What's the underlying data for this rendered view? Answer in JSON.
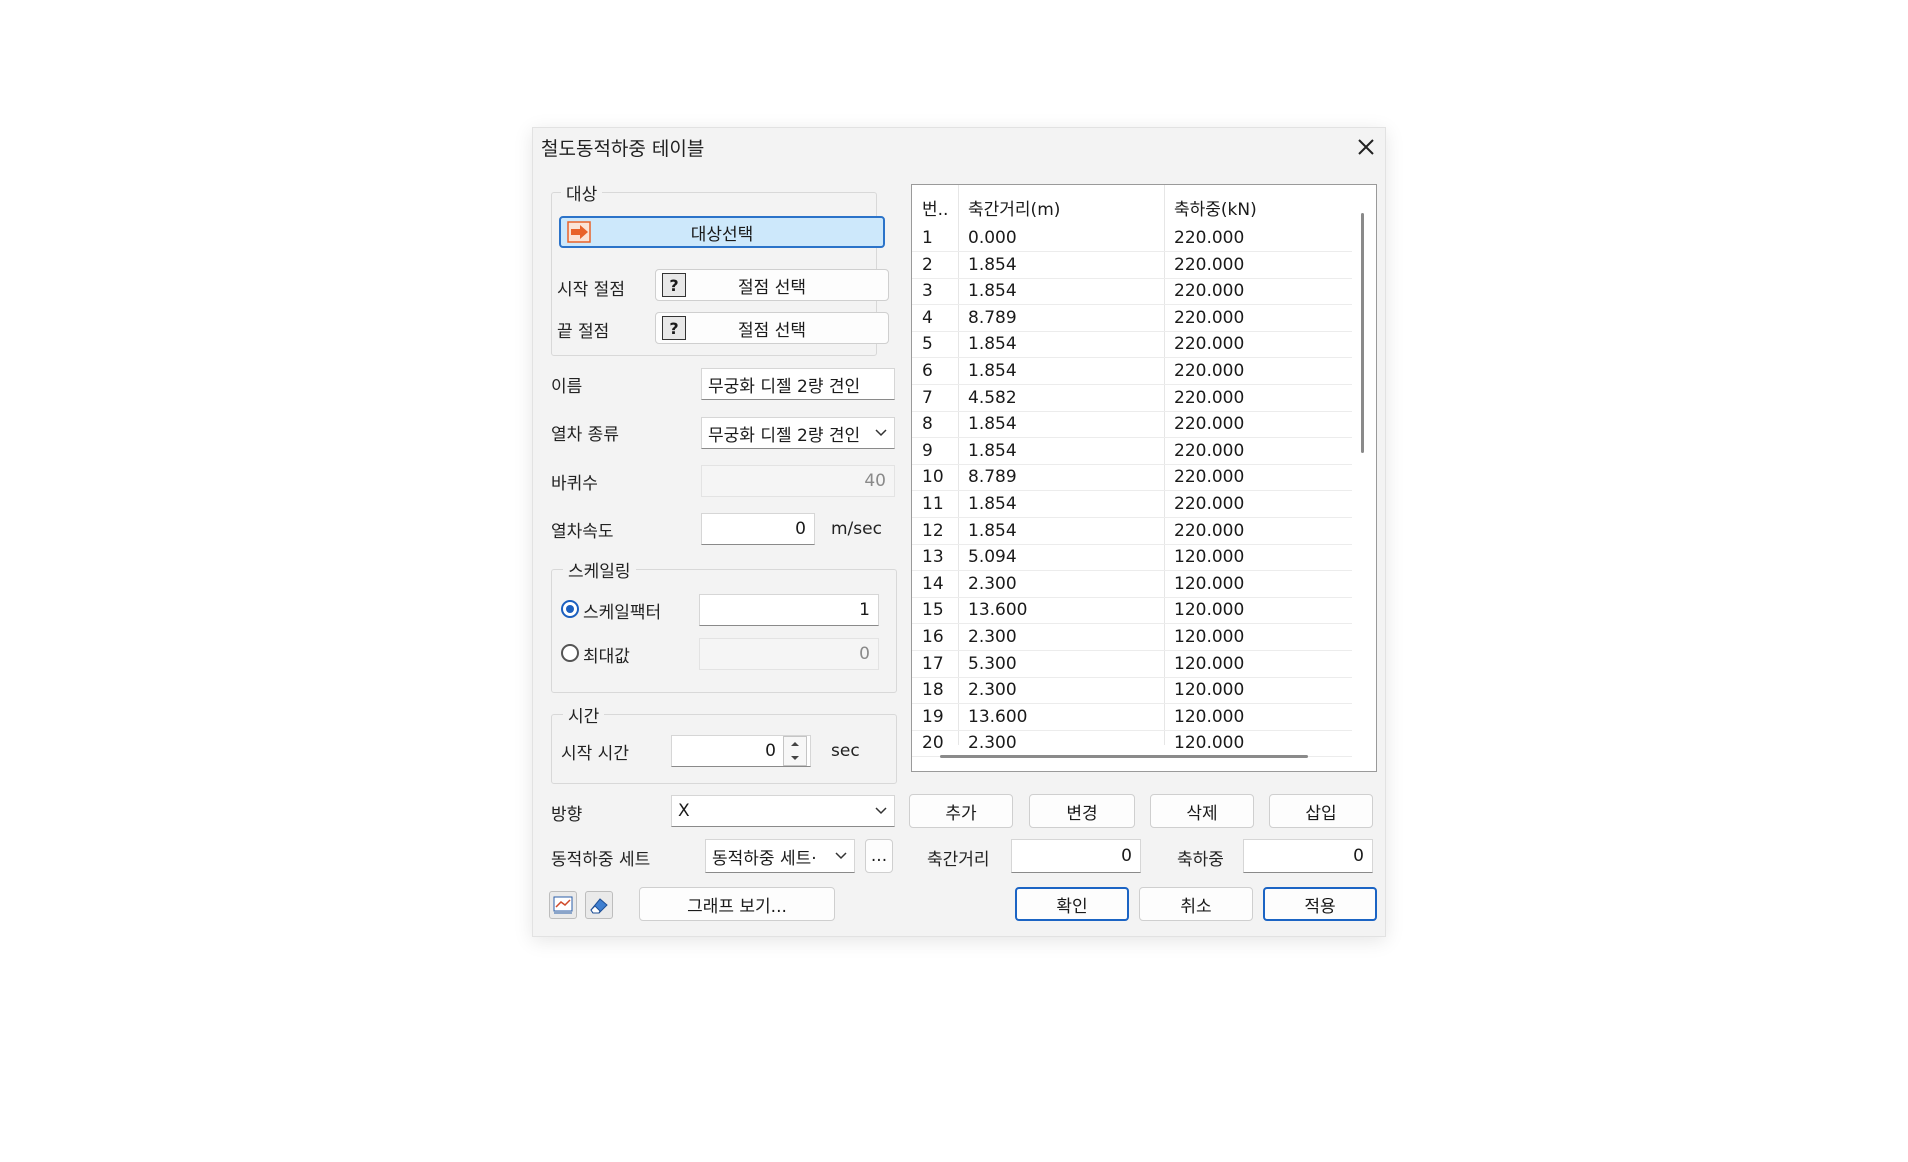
{
  "window": {
    "title": "철도동적하중 테이블"
  },
  "target_group": {
    "label": "대상",
    "select_button": "대상선택",
    "start_node_label": "시작 절점",
    "start_node_button": "절점 선택",
    "end_node_label": "끝 절점",
    "end_node_button": "절점 선택",
    "question_glyph": "?"
  },
  "name": {
    "label": "이름",
    "value": "무궁화 디젤 2량 견인"
  },
  "train_type": {
    "label": "열차 종류",
    "value": "무궁화 디젤 2량 견인"
  },
  "wheel_count": {
    "label": "바퀴수",
    "value": "40"
  },
  "train_speed": {
    "label": "열차속도",
    "value": "0",
    "unit": "m/sec"
  },
  "scaling": {
    "label": "스케일링",
    "factor_label": "스케일팩터",
    "factor_value": "1",
    "factor_selected": true,
    "max_label": "최대값",
    "max_value": "0"
  },
  "time": {
    "label": "시간",
    "start_label": "시작 시간",
    "start_value": "0",
    "unit": "sec"
  },
  "direction": {
    "label": "방향",
    "value": "X"
  },
  "dynamic_set": {
    "label": "동적하중 세트",
    "value": "동적하중 세트·",
    "more": "..."
  },
  "table": {
    "headers": [
      "번..",
      "축간거리(m)",
      "축하중(kN)"
    ],
    "rows": [
      [
        "1",
        "0.000",
        "220.000"
      ],
      [
        "2",
        "1.854",
        "220.000"
      ],
      [
        "3",
        "1.854",
        "220.000"
      ],
      [
        "4",
        "8.789",
        "220.000"
      ],
      [
        "5",
        "1.854",
        "220.000"
      ],
      [
        "6",
        "1.854",
        "220.000"
      ],
      [
        "7",
        "4.582",
        "220.000"
      ],
      [
        "8",
        "1.854",
        "220.000"
      ],
      [
        "9",
        "1.854",
        "220.000"
      ],
      [
        "10",
        "8.789",
        "220.000"
      ],
      [
        "11",
        "1.854",
        "220.000"
      ],
      [
        "12",
        "1.854",
        "220.000"
      ],
      [
        "13",
        "5.094",
        "120.000"
      ],
      [
        "14",
        "2.300",
        "120.000"
      ],
      [
        "15",
        "13.600",
        "120.000"
      ],
      [
        "16",
        "2.300",
        "120.000"
      ],
      [
        "17",
        "5.300",
        "120.000"
      ],
      [
        "18",
        "2.300",
        "120.000"
      ],
      [
        "19",
        "13.600",
        "120.000"
      ],
      [
        "20",
        "2.300",
        "120.000"
      ]
    ]
  },
  "row_actions": {
    "add": "추가",
    "change": "변경",
    "delete": "삭제",
    "insert": "삽입"
  },
  "axle_distance": {
    "label": "축간거리",
    "value": "0"
  },
  "axle_load": {
    "label": "축하중",
    "value": "0"
  },
  "footer": {
    "graph": "그래프 보기...",
    "ok": "확인",
    "cancel": "취소",
    "apply": "적용"
  },
  "colors": {
    "accent": "#1b64c4",
    "selected_bg": "#cde8fb",
    "dialog_bg": "#f3f3f3",
    "arrow_icon": "#e8622a"
  }
}
